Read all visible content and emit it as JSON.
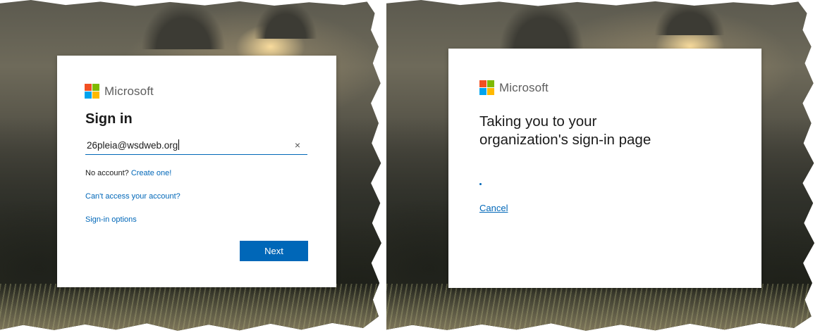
{
  "brand": {
    "name": "Microsoft",
    "logo_colors": [
      "#f25022",
      "#7fba00",
      "#00a4ef",
      "#ffb900"
    ],
    "accent": "#0067b8"
  },
  "left_panel": {
    "title": "Sign in",
    "email_value": "26pleia@wsdweb.org",
    "clear_icon": "×",
    "no_account_text": "No account?",
    "create_link": "Create one!",
    "cant_access_link": "Can't access your account?",
    "signin_options_link": "Sign-in options",
    "next_button": "Next"
  },
  "right_panel": {
    "title_line1": "Taking you to your",
    "title_line2": "organization's sign-in page",
    "cancel_link": "Cancel"
  }
}
